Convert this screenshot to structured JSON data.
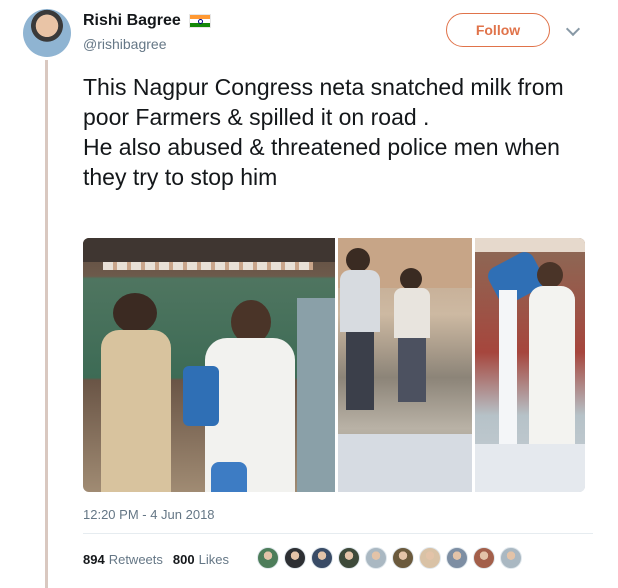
{
  "tweet": {
    "display_name": "Rishi Bagree",
    "handle": "@rishibagree",
    "follow_label": "Follow",
    "text_lines": [
      "This Nagpur Congress neta snatched milk from poor Farmers & spilled it on road .",
      "He also abused & threatened police men when they try to stop him"
    ],
    "timestamp": "12:20 PM - 4 Jun 2018",
    "retweets_count": "894",
    "retweets_label": "Retweets",
    "likes_count": "800",
    "likes_label": "Likes"
  },
  "colors": {
    "accent": "#e0734a",
    "secondary_text": "#657786"
  },
  "icons": {
    "flag": "india-flag-icon",
    "caret": "chevron-down-icon"
  },
  "likers": [
    {
      "color": "#4d7d5a"
    },
    {
      "color": "#2d2f33"
    },
    {
      "color": "#394b66"
    },
    {
      "color": "#3e4a3a"
    },
    {
      "color": "#aab8c2"
    },
    {
      "color": "#6b5a3d"
    },
    {
      "color": "#d9c2a6"
    },
    {
      "color": "#7d8ea3"
    },
    {
      "color": "#a35f4a"
    },
    {
      "color": "#aab8c2"
    }
  ]
}
